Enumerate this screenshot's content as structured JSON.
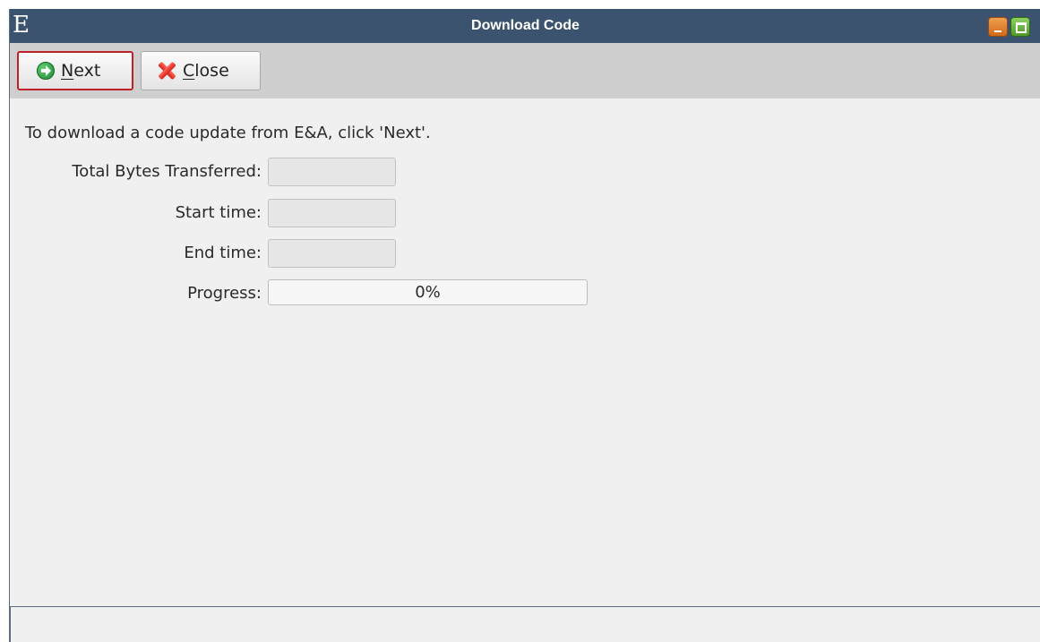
{
  "window": {
    "app_logo": "E",
    "title": "Download Code"
  },
  "toolbar": {
    "next": {
      "mnemonic": "N",
      "rest": "ext",
      "icon": "next-arrow-icon",
      "color": "#1e8a36"
    },
    "close": {
      "mnemonic": "C",
      "rest": "lose",
      "icon": "red-x-icon",
      "color": "#d61f1a"
    },
    "focus_color": "#c0202a"
  },
  "content": {
    "instruction": "To download a code update from E&A, click 'Next'.",
    "fields": {
      "total_bytes_label": "Total Bytes Transferred:",
      "total_bytes_value": "",
      "start_time_label": "Start time:",
      "start_time_value": "",
      "end_time_label": "End time:",
      "end_time_value": "",
      "progress_label": "Progress:",
      "progress_text": "0%",
      "progress_fraction": 0
    }
  },
  "status_bar": {
    "text": ""
  },
  "colors": {
    "titlebar": "#3c5370",
    "toolbar": "#cfcfcf",
    "background": "#f0f0f0"
  }
}
